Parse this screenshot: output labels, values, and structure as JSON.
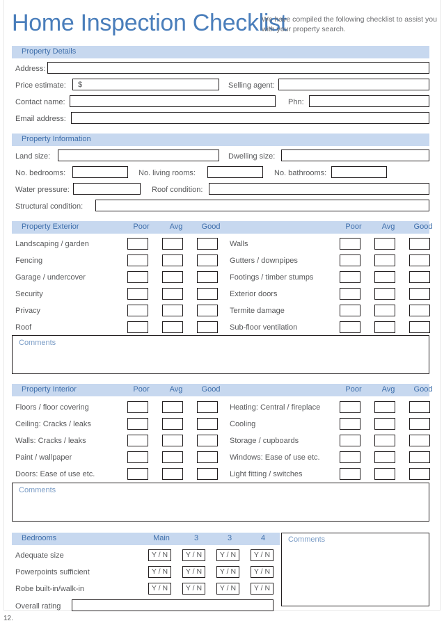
{
  "header": {
    "title": "Home Inspection Checklist",
    "intro": "We have compiled the following checklist to assist you with your property search."
  },
  "property_details": {
    "band_title": "Property Details",
    "fields": [
      {
        "label": "Address:",
        "value": ""
      },
      {
        "label": "Price estimate:",
        "value": "",
        "prefix": "$"
      },
      {
        "label": "Selling agent:",
        "value": ""
      },
      {
        "label": "Contact name:",
        "value": ""
      },
      {
        "label": "Phn:",
        "value": ""
      },
      {
        "label": "Email address:",
        "value": ""
      }
    ]
  },
  "property_information": {
    "band_title": "Property Information",
    "fields": [
      {
        "label": "Land size:",
        "value": ""
      },
      {
        "label": "Dwelling size:",
        "value": ""
      },
      {
        "label": "No. bedrooms:",
        "value": ""
      },
      {
        "label": "No. living rooms:",
        "value": ""
      },
      {
        "label": "No. bathrooms:",
        "value": ""
      },
      {
        "label": "Water pressure:",
        "value": ""
      },
      {
        "label": "Roof condition:",
        "value": ""
      },
      {
        "label": "Structural condition:",
        "value": ""
      }
    ]
  },
  "property_exterior": {
    "band_title": "Property Exterior",
    "rating_columns": [
      "Poor",
      "Avg",
      "Good"
    ],
    "left_items": [
      "Landscaping / garden",
      "Fencing",
      "Garage / undercover",
      "Security",
      "Privacy",
      "Roof"
    ],
    "right_items": [
      "Walls",
      "Gutters / downpipes",
      "Footings / timber stumps",
      "Exterior doors",
      "Termite damage",
      "Sub-floor ventilation"
    ],
    "comments_label": "Comments",
    "comments_value": ""
  },
  "property_interior": {
    "band_title": "Property Interior",
    "rating_columns": [
      "Poor",
      "Avg",
      "Good"
    ],
    "left_items": [
      "Floors / floor covering",
      "Ceiling: Cracks / leaks",
      "Walls: Cracks / leaks",
      "Paint / wallpaper",
      "Doors: Ease of use etc."
    ],
    "right_items": [
      "Heating: Central / fireplace",
      "Cooling",
      "Storage / cupboards",
      "Windows: Ease of use etc.",
      "Light fitting / switches"
    ],
    "comments_label": "Comments",
    "comments_value": ""
  },
  "bedrooms": {
    "band_title": "Bedrooms",
    "columns": [
      "Main",
      "3",
      "3",
      "4"
    ],
    "rows": [
      {
        "label": "Adequate size",
        "cells": [
          "Y / N",
          "Y / N",
          "Y / N",
          "Y / N"
        ]
      },
      {
        "label": "Powerpoints sufficient",
        "cells": [
          "Y / N",
          "Y / N",
          "Y / N",
          "Y / N"
        ]
      },
      {
        "label": "Robe built-in/walk-in",
        "cells": [
          "Y / N",
          "Y / N",
          "Y / N",
          "Y / N"
        ]
      }
    ],
    "overall_label": "Overall rating",
    "overall_value": "",
    "comments_label": "Comments",
    "comments_value": ""
  },
  "footer": {
    "page_number": "12."
  },
  "colors": {
    "band": "#c7d8ef",
    "band_text": "#3f6fab",
    "title": "#4a7ebb",
    "body_text": "#58595b",
    "border": "#231f20",
    "comments_text": "#7a9cc6"
  }
}
